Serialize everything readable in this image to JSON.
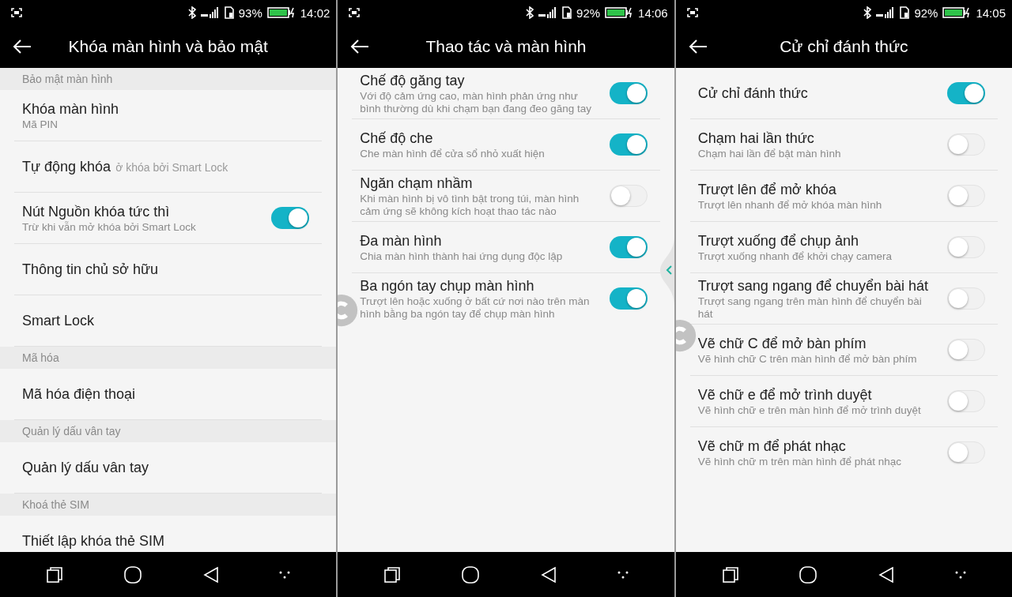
{
  "panels": [
    {
      "status": {
        "battery": "93%",
        "time": "14:02"
      },
      "title": "Khóa màn hình và bảo mật",
      "items": [
        {
          "kind": "header",
          "title": "Bảo mật màn hình"
        },
        {
          "kind": "item",
          "title": "Khóa màn hình",
          "subtitle": "Mã PIN"
        },
        {
          "kind": "item",
          "title": "Tự động khóa",
          "ghost": "ở khóa bởi Smart Lock"
        },
        {
          "kind": "toggle",
          "title": "Nút Nguồn khóa tức thì",
          "subtitle": "Trừ khi vẫn mở khóa bởi Smart Lock",
          "on": true
        },
        {
          "kind": "item",
          "title": "Thông tin chủ sở hữu"
        },
        {
          "kind": "item",
          "title": "Smart Lock"
        },
        {
          "kind": "header",
          "title": "Mã hóa"
        },
        {
          "kind": "item",
          "title": "Mã hóa điện thoại"
        },
        {
          "kind": "header",
          "title": "Quản lý dấu vân tay"
        },
        {
          "kind": "item",
          "title": "Quản lý dấu vân tay"
        },
        {
          "kind": "header",
          "title": "Khoá thẻ SIM"
        },
        {
          "kind": "item",
          "title": "Thiết lập khóa thẻ SIM"
        }
      ]
    },
    {
      "status": {
        "battery": "92%",
        "time": "14:06"
      },
      "title": "Thao tác và màn hình",
      "items": [
        {
          "kind": "toggle",
          "title": "Chế độ găng tay",
          "subtitle": "Với độ cảm ứng cao, màn hình phản ứng như bình thường dù khi chạm bạn đang đeo găng tay",
          "on": true
        },
        {
          "kind": "toggle",
          "title": "Chế độ che",
          "subtitle": "Che màn hình để cửa sổ nhỏ xuất hiện",
          "on": true
        },
        {
          "kind": "toggle",
          "title": "Ngăn chạm nhầm",
          "subtitle": "Khi màn hình bị vô tình bật trong túi, màn hình cảm ứng sẽ không kích hoạt thao tác nào",
          "on": false
        },
        {
          "kind": "toggle",
          "title": "Đa màn hình",
          "subtitle": "Chia màn hình thành hai ứng dụng độc lập",
          "on": true
        },
        {
          "kind": "toggle",
          "title": "Ba ngón tay chụp màn hình",
          "subtitle": "Trượt lên hoặc xuống ở bất cứ nơi  nào trên màn hình bằng ba ngón tay để chụp màn hình",
          "on": true
        }
      ]
    },
    {
      "status": {
        "battery": "92%",
        "time": "14:05"
      },
      "title": "Cử chỉ đánh thức",
      "items": [
        {
          "kind": "toggle",
          "title": "Cử chỉ đánh thức",
          "on": true
        },
        {
          "kind": "toggle",
          "title": "Chạm hai lần thức",
          "subtitle": "Chạm hai lần để bật màn hình",
          "on": false
        },
        {
          "kind": "toggle",
          "title": "Trượt lên để mở khóa",
          "subtitle": "Trượt lên nhanh để mở khóa màn hình",
          "on": false
        },
        {
          "kind": "toggle",
          "title": "Trượt xuống để chụp ảnh",
          "subtitle": "Trượt xuống nhanh để khởi chạy camera",
          "on": false
        },
        {
          "kind": "toggle",
          "title": "Trượt sang ngang để chuyển bài hát",
          "subtitle": "Trượt sang ngang trên màn hình để chuyển bài hát",
          "on": false
        },
        {
          "kind": "toggle",
          "title": "Vẽ chữ C để mở bàn phím",
          "subtitle": "Vẽ hình chữ C trên màn hình để mở bàn phím",
          "on": false
        },
        {
          "kind": "toggle",
          "title": "Vẽ chữ e để mở trình duyệt",
          "subtitle": "Vẽ hình chữ e trên màn hình để mở trình duyệt",
          "on": false
        },
        {
          "kind": "toggle",
          "title": "Vẽ chữ m để phát nhạc",
          "subtitle": "Vẽ hình chữ m trên màn hình để phát nhạc",
          "on": false
        }
      ]
    }
  ]
}
